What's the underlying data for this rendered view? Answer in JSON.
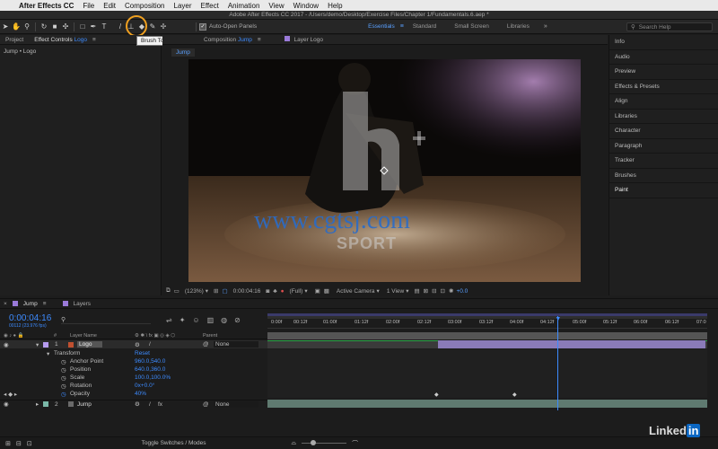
{
  "menubar": {
    "app": "After Effects CC",
    "items": [
      "File",
      "Edit",
      "Composition",
      "Layer",
      "Effect",
      "Animation",
      "View",
      "Window",
      "Help"
    ]
  },
  "titlebar": {
    "text": "Adobe After Effects CC 2017 - /Users/demo/Desktop/Exercise Files/Chapter 1/Fundamentals.6.aep *"
  },
  "toolbar": {
    "auto_open": "Auto-Open Panels",
    "workspaces": [
      "Essentials",
      "Standard",
      "Small Screen",
      "Libraries"
    ],
    "search_placeholder": "Search Help"
  },
  "left_panel": {
    "tab_project": "Project",
    "tab_effect_controls": "Effect Controls",
    "tab_effect_controls_target": "Logo",
    "tooltip": "Brush Tool (Cmd+B)",
    "breadcrumb": "Jump • Logo"
  },
  "viewer": {
    "tab_composition": "Composition",
    "tab_composition_name": "Jump",
    "tab_layer": "Layer Logo",
    "comp_chip": "Jump",
    "overlay_url": "www.cgtsj.com",
    "sport_text": "SPORT",
    "controls": {
      "zoom": "(123%)",
      "timecode": "0:00:04:16",
      "resolution": "(Full)",
      "camera": "Active Camera",
      "view": "1 View",
      "exposure": "+0.0"
    }
  },
  "right_panel": {
    "items": [
      "Info",
      "Audio",
      "Preview",
      "Effects & Presets",
      "Align",
      "Libraries",
      "Character",
      "Paragraph",
      "Tracker",
      "Brushes",
      "Paint"
    ],
    "active": "Paint"
  },
  "timeline": {
    "tab_comp": "Jump",
    "tab_layers": "Layers",
    "timecode": "0:00:04:16",
    "frame_info": "00112 (23.976 fps)",
    "col_layer_name": "Layer Name",
    "col_parent": "Parent",
    "ruler": [
      "0:00f",
      "00:12f",
      "01:00f",
      "01:12f",
      "02:00f",
      "02:12f",
      "03:00f",
      "03:12f",
      "04:00f",
      "04:12f",
      "05:00f",
      "05:12f",
      "06:00f",
      "06:12f",
      "07:0"
    ],
    "layers": [
      {
        "num": "1",
        "name": "Logo",
        "parent": "None"
      },
      {
        "num": "2",
        "name": "Jump",
        "parent": "None"
      }
    ],
    "transform": {
      "label": "Transform",
      "reset": "Reset",
      "props": [
        {
          "name": "Anchor Point",
          "value": "960.0,540.0"
        },
        {
          "name": "Position",
          "value": "640.0,360.0"
        },
        {
          "name": "Scale",
          "value": "100.0,100.0%"
        },
        {
          "name": "Rotation",
          "value": "0x+0.0°"
        },
        {
          "name": "Opacity",
          "value": "40%"
        }
      ]
    },
    "bottom_toggle": "Toggle Switches / Modes",
    "playhead_time_fraction": 0.66
  },
  "watermark": {
    "brand": "Linked",
    "brand_in": "in"
  }
}
